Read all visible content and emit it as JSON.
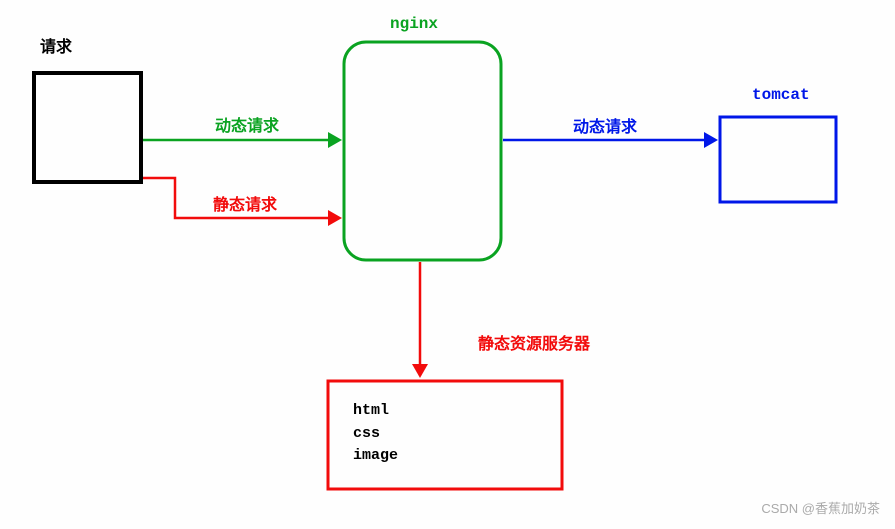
{
  "labels": {
    "request": "请求",
    "nginx": "nginx",
    "tomcat": "tomcat",
    "dynamic_request": "动态请求",
    "static_request": "静态请求",
    "static_server": "静态资源服务器"
  },
  "static_box": {
    "line1": "html",
    "line2": "css",
    "line3": "image"
  },
  "watermark": "CSDN @香蕉加奶茶",
  "colors": {
    "black": "#000000",
    "green": "#0aa321",
    "blue": "#0017e8",
    "red": "#f20b0b"
  }
}
